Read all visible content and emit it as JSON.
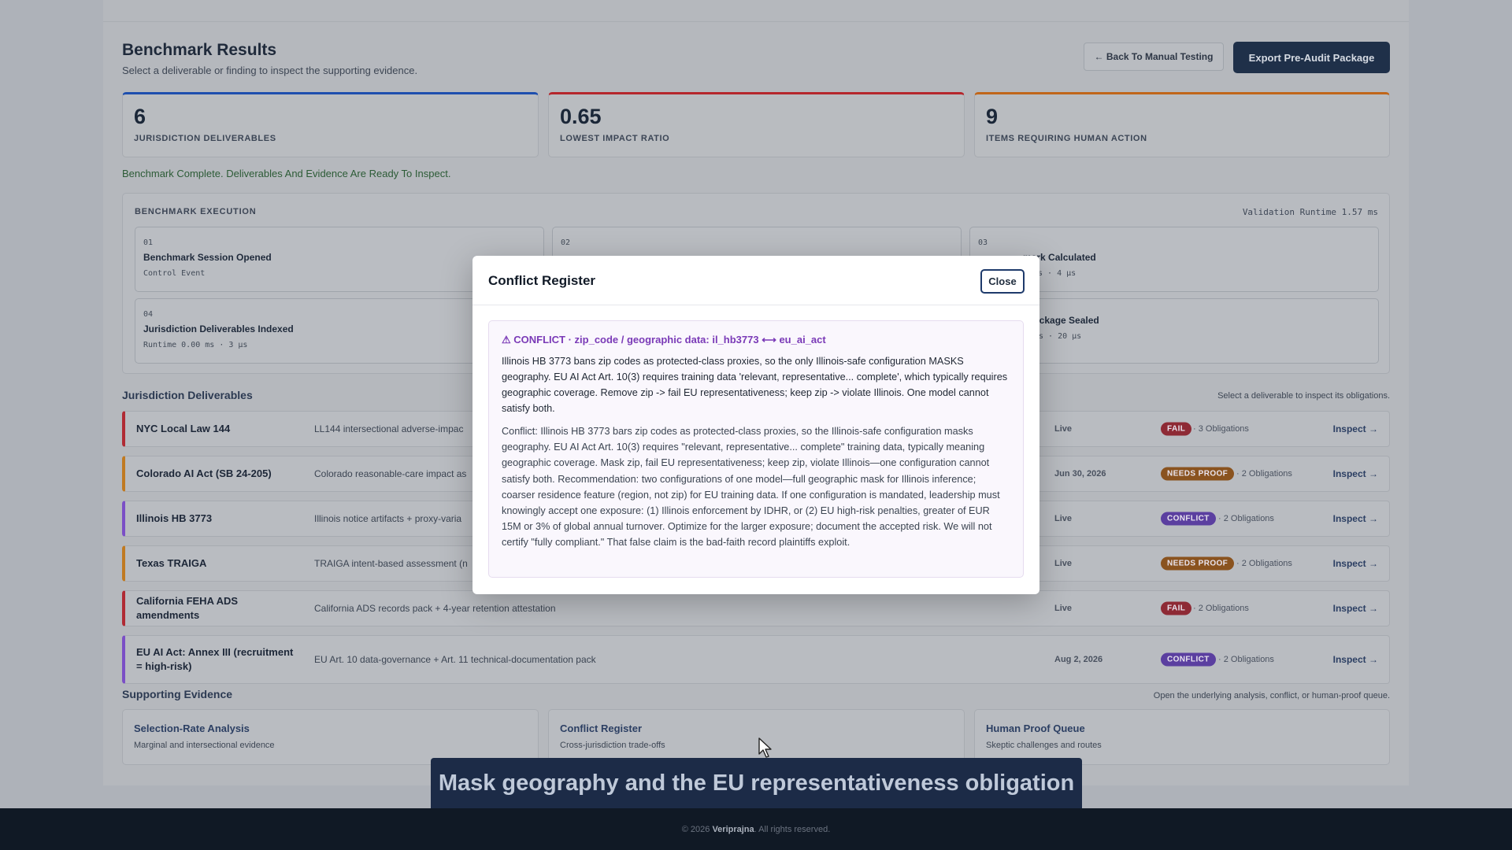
{
  "header": {
    "title": "Benchmark Results",
    "subtitle": "Select a deliverable or finding to inspect the supporting evidence.",
    "back_label": "← Back To Manual Testing",
    "export_label": "Export Pre-Audit Package"
  },
  "stats": [
    {
      "value": "6",
      "label": "Jurisdiction Deliverables",
      "accent": "#1e4fae"
    },
    {
      "value": "0.65",
      "label": "Lowest Impact Ratio",
      "accent": "#b5262c"
    },
    {
      "value": "9",
      "label": "Items Requiring Human Action",
      "accent": "#c0661a"
    }
  ],
  "status_message": "Benchmark Complete. Deliverables And Evidence Are Ready To Inspect.",
  "execution": {
    "title": "Benchmark Execution",
    "runtime": "Validation Runtime 1.57 ms",
    "steps": [
      {
        "num": "01",
        "title": "Benchmark Session Opened",
        "meta": "Control Event"
      },
      {
        "num": "02",
        "title": "",
        "meta": ""
      },
      {
        "num": "03",
        "title": "mark Calculated",
        "meta": "ms · 4 µs"
      },
      {
        "num": "04",
        "title": "Jurisdiction Deliverables Indexed",
        "meta": "Runtime 0.00 ms · 3 µs"
      },
      {
        "num": "",
        "title": "ackage Sealed",
        "meta": "ms · 20 µs"
      }
    ]
  },
  "deliverables": {
    "title": "Jurisdiction Deliverables",
    "hint": "Select a deliverable to inspect its obligations.",
    "rows": [
      {
        "name": "NYC Local Law 144",
        "desc": "LL144 intersectional adverse-impac",
        "due": "Live",
        "badge": "FAIL",
        "obligations": "· 3 Obligations",
        "inspect": "Inspect →"
      },
      {
        "name": "Colorado AI Act (SB 24-205)",
        "desc": "Colorado reasonable-care impact as",
        "due": "Jun 30, 2026",
        "badge": "NEEDS PROOF",
        "obligations": "· 2 Obligations",
        "inspect": "Inspect →"
      },
      {
        "name": "Illinois HB 3773",
        "desc": "Illinois notice artifacts + proxy-varia",
        "due": "Live",
        "badge": "CONFLICT",
        "obligations": "· 2 Obligations",
        "inspect": "Inspect →"
      },
      {
        "name": "Texas TRAIGA",
        "desc": "TRAIGA intent-based assessment (n",
        "due": "Live",
        "badge": "NEEDS PROOF",
        "obligations": "· 2 Obligations",
        "inspect": "Inspect →"
      },
      {
        "name": "California FEHA ADS amendments",
        "desc": "California ADS records pack + 4-year retention attestation",
        "due": "Live",
        "badge": "FAIL",
        "obligations": "· 2 Obligations",
        "inspect": "Inspect →"
      },
      {
        "name": "EU AI Act: Annex III (recruitment = high-risk)",
        "desc": "EU Art. 10 data-governance + Art. 11 technical-documentation pack",
        "due": "Aug 2, 2026",
        "badge": "CONFLICT",
        "obligations": "· 2 Obligations",
        "inspect": "Inspect →"
      }
    ]
  },
  "evidence": {
    "title": "Supporting Evidence",
    "hint": "Open the underlying analysis, conflict, or human-proof queue.",
    "cards": [
      {
        "title": "Selection-Rate Analysis",
        "subtitle": "Marginal and intersectional evidence"
      },
      {
        "title": "Conflict Register",
        "subtitle": "Cross-jurisdiction trade-offs"
      },
      {
        "title": "Human Proof Queue",
        "subtitle": "Skeptic challenges and routes"
      }
    ]
  },
  "modal": {
    "title": "Conflict Register",
    "close_label": "Close",
    "conflict_heading": "⚠ CONFLICT · zip_code / geographic data: il_hb3773 ⟷ eu_ai_act",
    "summary": "Illinois HB 3773 bans zip codes as protected-class proxies, so the only Illinois-safe configuration MASKS geography. EU AI Act Art. 10(3) requires training data 'relevant, representative... complete', which typically requires geographic coverage. Remove zip -> fail EU representativeness; keep zip -> violate Illinois. One model cannot satisfy both.",
    "detail": "Conflict: Illinois HB 3773 bars zip codes as protected-class proxies, so the Illinois-safe configuration masks geography. EU AI Act Art. 10(3) requires \"relevant, representative... complete\" training data, typically meaning geographic coverage. Mask zip, fail EU representativeness; keep zip, violate Illinois—one configuration cannot satisfy both. Recommendation: two configurations of one model—full geographic mask for Illinois inference; coarser residence feature (region, not zip) for EU training data. If one configuration is mandated, leadership must knowingly accept one exposure: (1) Illinois enforcement by IDHR, or (2) EU high-risk penalties, greater of EUR 15M or 3% of global annual turnover. Optimize for the larger exposure; document the accepted risk. We will not certify \"fully compliant.\" That false claim is the bad-faith record plaintiffs exploit."
  },
  "caption": "Mask geography and the EU representativeness obligation",
  "footer": {
    "prefix": "© 2026",
    "brand": "Veriprajna",
    "suffix": ". All rights reserved."
  },
  "colors": {
    "fail": "#8e2a35",
    "needs_proof": "#8a531f",
    "conflict": "#5b3fa0",
    "row_accent_fail": "#b02a34",
    "row_accent_needs_proof": "#c07a22",
    "row_accent_conflict": "#7b4fc6"
  }
}
